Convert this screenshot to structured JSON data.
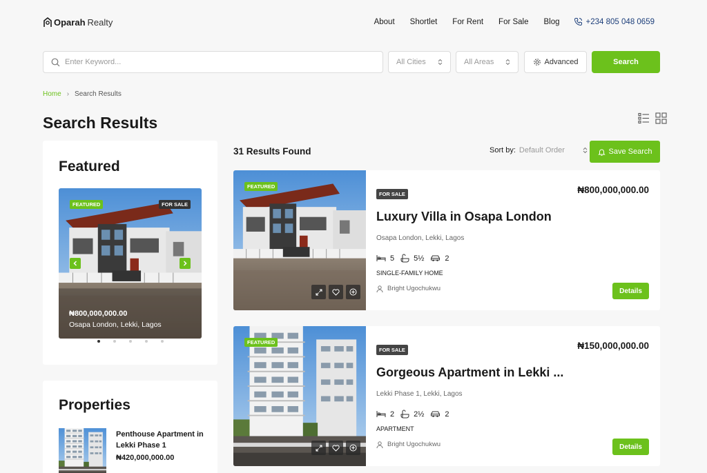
{
  "header": {
    "logo_bold": "Oparah",
    "logo_light": "Realty",
    "nav": [
      "About",
      "Shortlet",
      "For Rent",
      "For Sale",
      "Blog"
    ],
    "phone": "+234 805 048 0659",
    "accent": "#6cc11c"
  },
  "search": {
    "placeholder": "Enter Keyword...",
    "cities": "All Cities",
    "areas": "All Areas",
    "advanced": "Advanced",
    "button": "Search"
  },
  "breadcrumb": {
    "home": "Home",
    "current": "Search Results"
  },
  "page_title": "Search Results",
  "sidebar": {
    "featured_title": "Featured",
    "featured": {
      "badge_featured": "FEATURED",
      "badge_status": "FOR SALE",
      "price": "₦800,000,000.00",
      "location": "Osapa London, Lekki, Lagos"
    },
    "properties_title": "Properties",
    "property": {
      "title": "Penthouse Apartment in Lekki Phase 1",
      "price": "₦420,000,000.00"
    }
  },
  "results": {
    "count": "31 Results Found",
    "sort_label": "Sort by:",
    "sort_value": "Default Order",
    "save_search": "Save Search",
    "listings": [
      {
        "badge": "FEATURED",
        "status": "FOR SALE",
        "price": "₦800,000,000.00",
        "title": "Luxury Villa in Osapa London",
        "location": "Osapa London, Lekki, Lagos",
        "beds": "5",
        "baths": "5½",
        "garages": "2",
        "type": "SINGLE-FAMILY HOME",
        "agent": "Bright Ugochukwu",
        "details": "Details"
      },
      {
        "badge": "FEATURED",
        "status": "FOR SALE",
        "price": "₦150,000,000.00",
        "title": "Gorgeous Apartment in Lekki ...",
        "location": "Lekki Phase 1, Lekki, Lagos",
        "beds": "2",
        "baths": "2½",
        "garages": "2",
        "type": "APARTMENT",
        "agent": "Bright Ugochukwu",
        "details": "Details"
      }
    ]
  }
}
